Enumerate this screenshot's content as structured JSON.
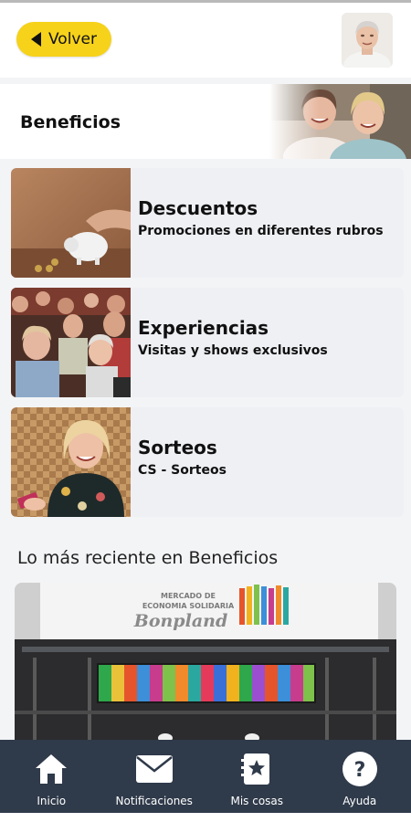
{
  "header": {
    "back_label": "Volver"
  },
  "page": {
    "title": "Beneficios"
  },
  "cards": [
    {
      "title": "Descuentos",
      "subtitle": "Promociones en diferentes rubros"
    },
    {
      "title": "Experiencias",
      "subtitle": "Visitas y shows exclusivos"
    },
    {
      "title": "Sorteos",
      "subtitle": "CS - Sorteos"
    }
  ],
  "recent": {
    "title": "Lo más reciente en Beneficios",
    "banner_sign_line1": "MERCADO DE",
    "banner_sign_line2": "ECONOMIA SOLIDARIA",
    "banner_sign_brand": "Bonpland"
  },
  "tabs": [
    {
      "label": "Inicio",
      "icon": "home-icon"
    },
    {
      "label": "Notificaciones",
      "icon": "envelope-icon"
    },
    {
      "label": "Mis cosas",
      "icon": "bookmark-star-icon"
    },
    {
      "label": "Ayuda",
      "icon": "help-icon"
    }
  ],
  "colors": {
    "accent_yellow": "#f6d21a",
    "tabbar": "#2f3a4a",
    "card_bg": "#eef0f4"
  }
}
